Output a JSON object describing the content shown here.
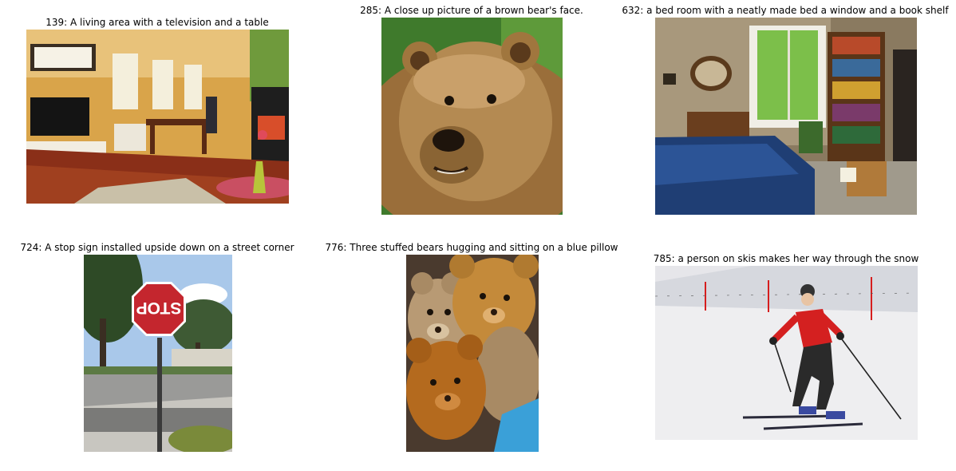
{
  "figures": [
    {
      "caption": "139: A living area with a television and a table"
    },
    {
      "caption": "285: A close up picture of a brown bear's face."
    },
    {
      "caption": "632: a bed room with a neatly made bed a window and a book shelf"
    },
    {
      "caption": "724: A stop sign installed upside down on a street corner"
    },
    {
      "caption": "776: Three stuffed bears hugging and sitting on a blue pillow"
    },
    {
      "caption": "785: a person on skis makes her way through the snow"
    }
  ],
  "photo_text": {
    "stop_sign": "STOP"
  }
}
